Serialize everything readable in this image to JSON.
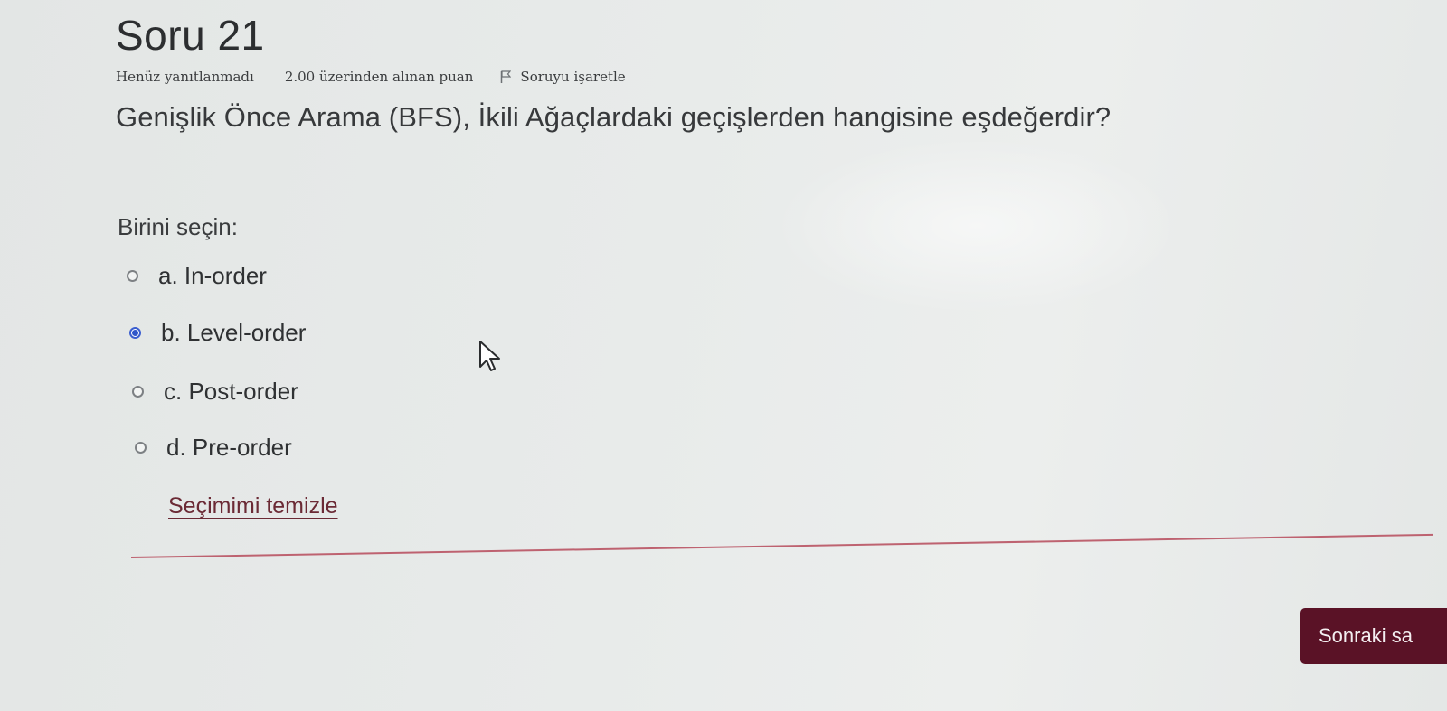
{
  "question": {
    "title": "Soru 21",
    "state": "Henüz yanıtlanmadı",
    "grade": "2.00 üzerinden alınan puan",
    "flag_label": "Soruyu işaretle",
    "flag_icon": "flag-icon",
    "text": "Genişlik Önce Arama (BFS), İkili Ağaçlardaki geçişlerden hangisine eşdeğerdir?",
    "prompt": "Birini seçin:",
    "answers": [
      {
        "label": "a. In-order",
        "selected": false
      },
      {
        "label": "b. Level-order",
        "selected": true
      },
      {
        "label": "c. Post-order",
        "selected": false
      },
      {
        "label": "d. Pre-order",
        "selected": false
      }
    ],
    "clear_label": "Seçimimi temizle"
  },
  "navigation": {
    "next_label": "Sonraki sa"
  },
  "colors": {
    "accent": "#5a1226",
    "link": "#6b2a35",
    "selected_radio": "#2f56c9",
    "divider": "#b64a5a"
  }
}
